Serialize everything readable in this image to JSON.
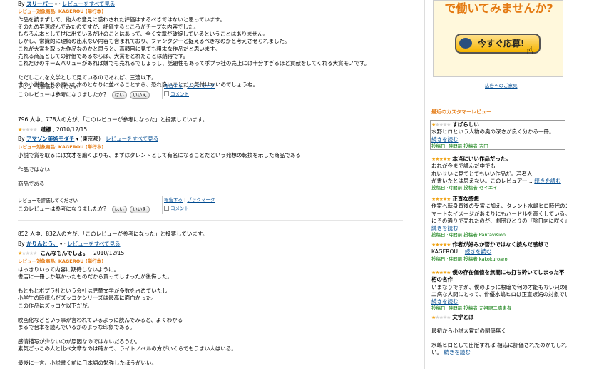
{
  "review1": {
    "by_prefix": "By",
    "reviewer": "スリーパー",
    "all_reviews": "レビューをすべて見る",
    "product": "レビュー対象商品: KAGEROU (単行本)",
    "body": [
      "作品を読まずして、他人の意見に惑わされた評価はするべきではないと思っています。",
      "そのため早速読んでみたのですが、評価するところがチープな内容でした。",
      "もちろん本として世に出ているだけのことはあって、全く文章が破綻しているということはありません。",
      "しかし、常識的に理解の出来ない内容も含まれており、ファンタジーと捉えるべきなのかと考えさせられました。",
      "これが大賞を取った作品なのかと思うと、高額目に見ても粗末な作品だと思います。",
      "売れる商品としての評価であるならば、大賞をとれたことは納得です。",
      "これだけのネームバリューがあれば嫌でも売れるでしょうし、話題性もあってポプラ社の売上には十分すぎるほど貢献をしてくれる大賞モノです。",
      "",
      "ただしこれを文学として見ているのであれば、三流以下。",
      "世の小説家たちの書いた本のとなりに並べることすら、恐れ多いことだと気付けないのでしょうね。"
    ],
    "rate_label": "レビューを評価してください",
    "helpful_q": "このレビューは参考になりましたか？",
    "yes": "はい",
    "no": "いいえ",
    "report": "報告する",
    "bookmark": "ブックマーク",
    "comment": "コメント"
  },
  "review2": {
    "helpful": "796 人中、778人の方が、「このレビューが参考になった」と投票しています。",
    "rating": 1,
    "title": "道標",
    "date": ", 2010/12/15",
    "by_prefix": "By",
    "reviewer": "アマゾン美術モダチ",
    "location": "(東京都)",
    "all_reviews": "レビューをすべて見る",
    "product": "レビュー対象商品: KAGEROU (単行本)",
    "body": [
      "小説で賞を取るには文才を磨くよりも、まずはタレントとして有名になることだという発想の転換を示した商品である",
      "",
      "作品ではない",
      "",
      "商品である"
    ],
    "rate_label": "レビューを評価してください",
    "helpful_q": "このレビューは参考になりましたか？",
    "yes": "はい",
    "no": "いいえ",
    "report": "報告する",
    "bookmark": "ブックマーク",
    "comment": "コメント"
  },
  "review3": {
    "helpful": "852 人中、832人の方が、「このレビューが参考になった」と投票しています。",
    "rating": 1,
    "title": "こんなもんでしょ。",
    "date": ", 2010/12/15",
    "by_prefix": "By",
    "reviewer": "かりんとう。",
    "all_reviews": "レビューをすべて見る",
    "product": "レビュー対象商品: KAGEROU (単行本)",
    "body": [
      "はっきりいって内容に期待しないように。",
      "書店に一冊しか無かったものだから買ってしまったが後悔した。",
      "",
      "もともとポプラ社という会社は児童文学が多数を占めていたし",
      "小学生の時読んだズッコケシリーズは最高に面白かった。",
      "この作品はズッコケ以下だが。",
      "",
      "映画化などという事が言われているように読んでみると、よくわかる",
      "まるで台本を読んでいるかのような印象である。",
      "",
      "感情描写が少ないのが原因なのではないだろうか。",
      "素気ごっこの人と比べ文章なのは確かで、ライトノベルの方がいくらでもうまい人はいる。",
      "",
      "最後に一言、小説書く前に日本語の勉強したほうがいい。"
    ]
  },
  "sidebar": {
    "banner_text": "で働いてみませんか?",
    "apply_button": "今すぐ応募!",
    "ad_feedback": "広告へのご意見",
    "recent_header": "最近のカスタマーレビュー",
    "items": [
      {
        "rating": 1,
        "title": "すばらしい",
        "lines": [
          "水野ヒロという人物の奥の深さが良く分かる一冊。"
        ],
        "more": "続きを読む",
        "meta": "投稿日 ·時間前 投稿者 吉田"
      },
      {
        "rating": 5,
        "title": "本当にいい作品だった。",
        "lines": [
          "おれが今まで読んだ中でも",
          "れいせいに見てとてもいい作品だ。若者人",
          "が書いたとは思えない。このレビュアー…"
        ],
        "more": "続きを読む",
        "meta": "投稿日 ·時間前 投稿者 セイエイ"
      },
      {
        "rating": 5,
        "title": "正直な感想",
        "lines": [
          "作家へ転身直後の受賞に加え、タレント水嶋ヒロ時代のス",
          "マートなイメージがあまりにもハードルを高くしている。まさ",
          "にその通りで売れたのが、劇団ひとりの『陰日向に咲く』の…"
        ],
        "more": "続きを読む",
        "meta": "投稿日 ·時間前 投稿者 Pantavision"
      },
      {
        "rating": 5,
        "title": "作者が好みか否かではなく読んだ感想で",
        "lines": [
          "KAGEROU…"
        ],
        "more": "続きを読む",
        "meta": "投稿日 ·時間前 投稿者 kakokuroaro"
      },
      {
        "rating": 5,
        "title": "僕の存在価値を無闇にも打ち砕いてしまった不朽の名作",
        "lines": [
          "いまなりですが、僕のように根暗で何の才能もない只の厨",
          "二病な人間にとって、俳優水嶋ヒロは正直嫉妬の対象でし…"
        ],
        "more": "続きを読む",
        "meta": "投稿日 ·時間前 投稿者 元祖厨二病患者"
      },
      {
        "rating": 1,
        "title": "文学とは",
        "lines": [
          "",
          "最初から小説大賞だの関係無く",
          "",
          "水嶋ヒロとして出版すれば 相応に評価されたのかもしれな",
          "い。"
        ],
        "more": "続きを読む",
        "meta": ""
      }
    ]
  },
  "colors": {
    "accent": "#e47911",
    "link": "#004b91",
    "star": "#f0a51a",
    "meta": "#007600"
  }
}
